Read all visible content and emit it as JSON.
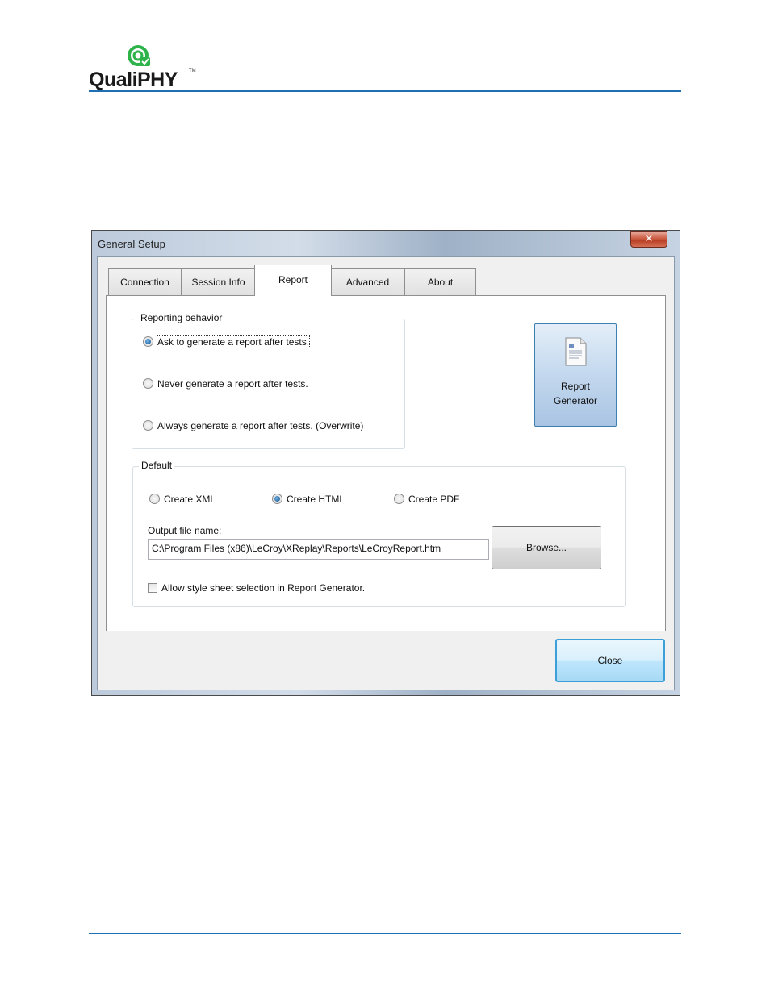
{
  "brand": {
    "name": "QualiPHY",
    "trademark": "TM",
    "colors": {
      "accent": "#1f6fb4",
      "logo_green": "#2eb34a"
    }
  },
  "dialog": {
    "title": "General Setup",
    "close_glyph": "✕",
    "tabs": [
      {
        "label": "Connection",
        "active": false
      },
      {
        "label": "Session Info",
        "active": false
      },
      {
        "label": "Report",
        "active": true
      },
      {
        "label": "Advanced",
        "active": false
      },
      {
        "label": "About",
        "active": false
      }
    ],
    "reporting_behavior": {
      "label": "Reporting behavior",
      "options": [
        {
          "label": "Ask to generate a report after tests.",
          "selected": true
        },
        {
          "label": "Never generate a report after tests.",
          "selected": false
        },
        {
          "label": "Always generate a report after tests. (Overwrite)",
          "selected": false
        }
      ]
    },
    "report_generator_button": {
      "line1": "Report",
      "line2": "Generator",
      "icon": "document-icon"
    },
    "default_group": {
      "label": "Default",
      "formats": [
        {
          "label": "Create XML",
          "selected": false
        },
        {
          "label": "Create HTML",
          "selected": true
        },
        {
          "label": "Create PDF",
          "selected": false
        }
      ],
      "output_label": "Output file name:",
      "output_value": "C:\\Program Files (x86)\\LeCroy\\XReplay\\Reports\\LeCroyReport.htm",
      "browse_label": "Browse...",
      "style_sheet_label": "Allow style sheet selection in Report Generator.",
      "style_sheet_checked": false
    },
    "close_label": "Close"
  }
}
